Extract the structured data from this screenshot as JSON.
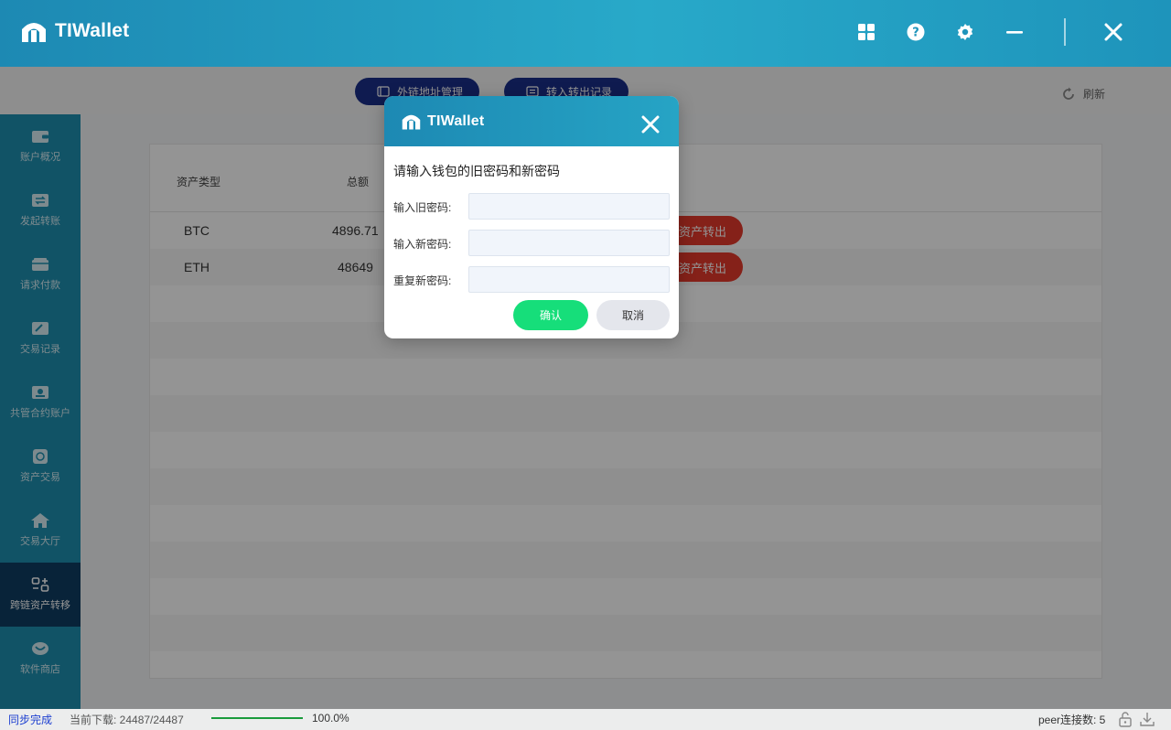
{
  "app": {
    "title": "TIWallet"
  },
  "header": {
    "icons": [
      "grid-icon",
      "help-icon",
      "settings-icon",
      "minimize-icon",
      "close-icon"
    ]
  },
  "toolbar": {
    "external_address_label": "外链地址管理",
    "transfer_records_label": "转入转出记录",
    "refresh_label": "刷新"
  },
  "sidebar": {
    "items": [
      {
        "label": "账户概况",
        "icon": "wallet-icon"
      },
      {
        "label": "发起转账",
        "icon": "transfer-icon"
      },
      {
        "label": "请求付款",
        "icon": "payment-icon"
      },
      {
        "label": "交易记录",
        "icon": "record-icon"
      },
      {
        "label": "共管合约账户",
        "icon": "contract-icon"
      },
      {
        "label": "资产交易",
        "icon": "asset-trade-icon"
      },
      {
        "label": "交易大厅",
        "icon": "home-icon"
      },
      {
        "label": "跨链资产转移",
        "icon": "cross-chain-icon"
      },
      {
        "label": "软件商店",
        "icon": "store-icon"
      }
    ],
    "active_index": 7
  },
  "table": {
    "columns": [
      "资产类型",
      "总额"
    ],
    "rows": [
      {
        "asset": "BTC",
        "total": "4896.71",
        "action": "资产转出"
      },
      {
        "asset": "ETH",
        "total": "48649",
        "action": "资产转出"
      }
    ]
  },
  "modal": {
    "title": "TIWallet",
    "heading": "请输入钱包的旧密码和新密码",
    "fields": [
      {
        "label": "输入旧密码:",
        "value": ""
      },
      {
        "label": "输入新密码:",
        "value": ""
      },
      {
        "label": "重复新密码:",
        "value": ""
      }
    ],
    "confirm_label": "确认",
    "cancel_label": "取消"
  },
  "status": {
    "sync": "同步完成",
    "download": "当前下载: 24487/24487",
    "progress_percent": 100.0,
    "progress_text": "100.0%",
    "peers": "peer连接数: 5"
  },
  "colors": {
    "header": "#1d89b3",
    "sidebar": "#1e8fb0",
    "sidebar_active": "#0f3d63",
    "pill_button": "#1b2f8a",
    "danger": "#e53a2b",
    "confirm": "#16de7a"
  }
}
